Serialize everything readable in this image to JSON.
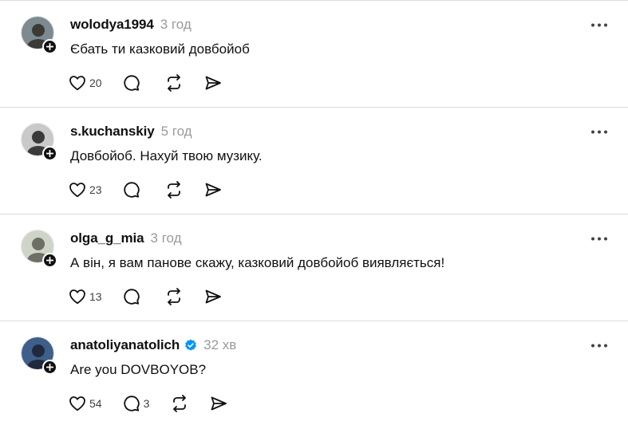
{
  "posts": [
    {
      "username": "wolodya1994",
      "time": "3 год",
      "verified": false,
      "text": "Єбать ти казковий довбойоб",
      "likes": "20",
      "comments": "",
      "avatar_colors": [
        "#7d8a8f",
        "#3b3a36"
      ]
    },
    {
      "username": "s.kuchanskiy",
      "time": "5 год",
      "verified": false,
      "text": "Довбойоб. Нахуй твою музику.",
      "likes": "23",
      "comments": "",
      "avatar_colors": [
        "#c9c9c9",
        "#3a3a3a"
      ]
    },
    {
      "username": "olga_g_mia",
      "time": "3 год",
      "verified": false,
      "text": "А він, я вам панове скажу, казковий довбойоб виявляється!",
      "likes": "13",
      "comments": "",
      "avatar_colors": [
        "#cfd4c8",
        "#6b6f64"
      ]
    },
    {
      "username": "anatoliyanatolich",
      "time": "32 хв",
      "verified": true,
      "text": "Are you DOVBOYOB?",
      "likes": "54",
      "comments": "3",
      "avatar_colors": [
        "#3e5f8a",
        "#1f2b3d"
      ]
    }
  ],
  "colors": {
    "verified": "#0095f6",
    "muted": "#9a9a9a",
    "divider": "#dcdcdc"
  },
  "icons": {
    "like": "heart-icon",
    "comment": "comment-bubble-icon",
    "repost": "repost-icon",
    "share": "send-icon",
    "more": "more-horizontal-icon",
    "follow": "plus-icon"
  }
}
